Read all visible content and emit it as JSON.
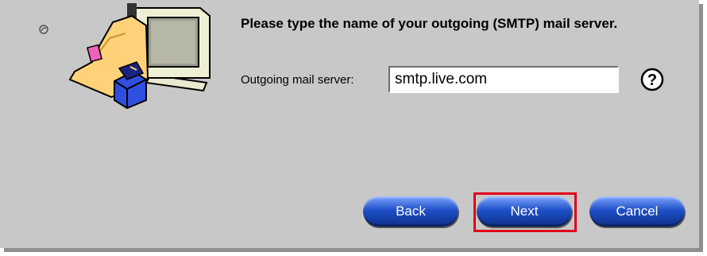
{
  "wizard": {
    "heading": "Please type the name of your outgoing (SMTP) mail server.",
    "field_label": "Outgoing mail server:",
    "field_value": "smtp.live.com",
    "help_symbol": "?",
    "back_label": "Back",
    "next_label": "Next",
    "cancel_label": "Cancel"
  },
  "icons": {
    "small": "small-logo-icon",
    "illustration": "computer-mail-illustration-icon",
    "help": "help-icon"
  },
  "colors": {
    "panel_bg": "#c8c8c8",
    "button_blue": "#1f50c8",
    "highlight_red": "#e0001b"
  }
}
